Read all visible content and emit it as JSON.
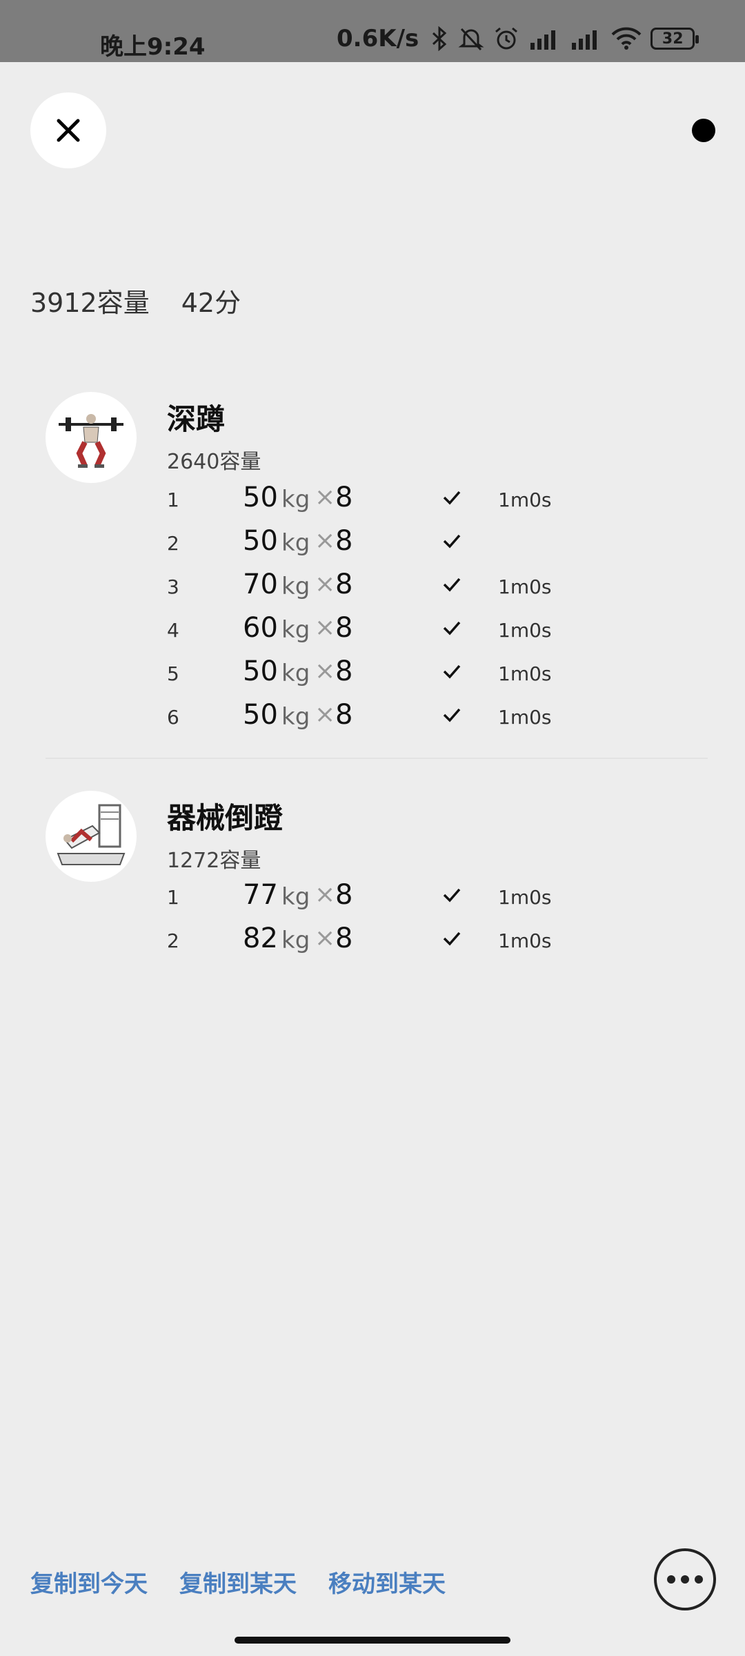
{
  "status_bar": {
    "time": "晚上9:24",
    "net_speed": "0.6K/s",
    "battery": "32"
  },
  "summary": {
    "volume": "3912容量",
    "duration": "42分"
  },
  "exercises": [
    {
      "name": "深蹲",
      "volume": "2640容量",
      "sets": [
        {
          "index": "1",
          "weight": "50",
          "unit": "kg",
          "times": "×",
          "reps": "8",
          "rest": "1m0s"
        },
        {
          "index": "2",
          "weight": "50",
          "unit": "kg",
          "times": "×",
          "reps": "8",
          "rest": ""
        },
        {
          "index": "3",
          "weight": "70",
          "unit": "kg",
          "times": "×",
          "reps": "8",
          "rest": "1m0s"
        },
        {
          "index": "4",
          "weight": "60",
          "unit": "kg",
          "times": "×",
          "reps": "8",
          "rest": "1m0s"
        },
        {
          "index": "5",
          "weight": "50",
          "unit": "kg",
          "times": "×",
          "reps": "8",
          "rest": "1m0s"
        },
        {
          "index": "6",
          "weight": "50",
          "unit": "kg",
          "times": "×",
          "reps": "8",
          "rest": "1m0s"
        }
      ]
    },
    {
      "name": "器械倒蹬",
      "volume": "1272容量",
      "sets": [
        {
          "index": "1",
          "weight": "77",
          "unit": "kg",
          "times": "×",
          "reps": "8",
          "rest": "1m0s"
        },
        {
          "index": "2",
          "weight": "82",
          "unit": "kg",
          "times": "×",
          "reps": "8",
          "rest": "1m0s"
        }
      ]
    }
  ],
  "actions": {
    "copy_today": "复制到今天",
    "copy_day": "复制到某天",
    "move_day": "移动到某天"
  },
  "colors": {
    "accent": "#4a7fc0",
    "background": "#ededed"
  }
}
